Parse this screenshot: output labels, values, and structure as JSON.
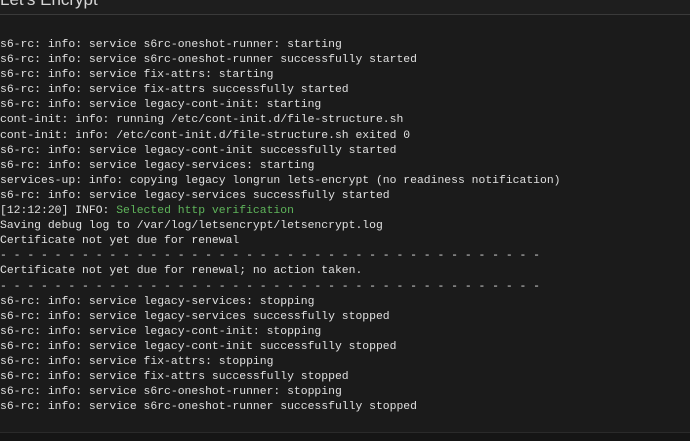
{
  "window": {
    "title": "Let's Encrypt"
  },
  "log": {
    "lines": [
      "s6-rc: info: service s6rc-oneshot-runner: starting",
      "s6-rc: info: service s6rc-oneshot-runner successfully started",
      "s6-rc: info: service fix-attrs: starting",
      "s6-rc: info: service fix-attrs successfully started",
      "s6-rc: info: service legacy-cont-init: starting",
      "cont-init: info: running /etc/cont-init.d/file-structure.sh",
      "cont-init: info: /etc/cont-init.d/file-structure.sh exited 0",
      "s6-rc: info: service legacy-cont-init successfully started",
      "s6-rc: info: service legacy-services: starting",
      "services-up: info: copying legacy longrun lets-encrypt (no readiness notification)",
      "s6-rc: info: service legacy-services successfully started",
      "",
      "Saving debug log to /var/log/letsencrypt/letsencrypt.log",
      "Certificate not yet due for renewal",
      "- - - - - - - - - - - - - - - - - - - - - - - - - - - - - - - - - - - - - - - -",
      "Certificate not yet due for renewal; no action taken.",
      "- - - - - - - - - - - - - - - - - - - - - - - - - - - - - - - - - - - - - - - -",
      "s6-rc: info: service legacy-services: stopping",
      "s6-rc: info: service legacy-services successfully stopped",
      "s6-rc: info: service legacy-cont-init: stopping",
      "s6-rc: info: service legacy-cont-init successfully stopped",
      "s6-rc: info: service fix-attrs: stopping",
      "s6-rc: info: service fix-attrs successfully stopped",
      "s6-rc: info: service s6rc-oneshot-runner: stopping",
      "s6-rc: info: service s6rc-oneshot-runner successfully stopped"
    ],
    "info_line": {
      "prefix": "[12:12:20] INFO: ",
      "message": "Selected http verification"
    }
  },
  "colors": {
    "background": "#1b1b1b",
    "text": "#e0e0e0",
    "info_green": "#5fb55b"
  }
}
